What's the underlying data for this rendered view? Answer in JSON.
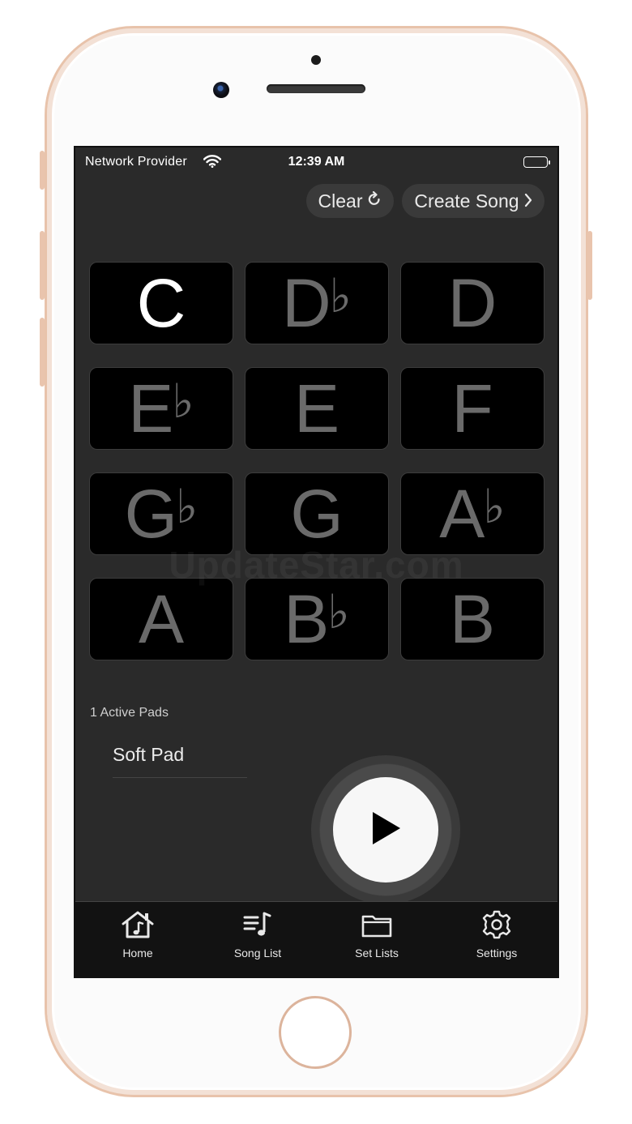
{
  "status_bar": {
    "provider": "Network Provider",
    "time": "12:39 AM"
  },
  "header": {
    "clear_label": "Clear",
    "create_song_label": "Create Song"
  },
  "pads": [
    {
      "note": "C",
      "flat": "",
      "active": true
    },
    {
      "note": "D",
      "flat": "♭",
      "active": false
    },
    {
      "note": "D",
      "flat": "",
      "active": false
    },
    {
      "note": "E",
      "flat": "♭",
      "active": false
    },
    {
      "note": "E",
      "flat": "",
      "active": false
    },
    {
      "note": "F",
      "flat": "",
      "active": false
    },
    {
      "note": "G",
      "flat": "♭",
      "active": false
    },
    {
      "note": "G",
      "flat": "",
      "active": false
    },
    {
      "note": "A",
      "flat": "♭",
      "active": false
    },
    {
      "note": "A",
      "flat": "",
      "active": false
    },
    {
      "note": "B",
      "flat": "♭",
      "active": false
    },
    {
      "note": "B",
      "flat": "",
      "active": false
    }
  ],
  "watermark": "UpdateStar.com",
  "active_pads": "1 Active Pads",
  "current_pad": "Soft Pad",
  "tabs": [
    {
      "label": "Home",
      "icon": "home-music-icon"
    },
    {
      "label": "Song List",
      "icon": "song-list-icon"
    },
    {
      "label": "Set Lists",
      "icon": "folder-icon"
    },
    {
      "label": "Settings",
      "icon": "gear-icon"
    }
  ],
  "colors": {
    "screen_bg": "#2a2a2a",
    "pad_bg": "#000000",
    "pad_active_text": "#ffffff",
    "pad_inactive_text": "#6a6a6a",
    "tab_bar_bg": "#121212"
  }
}
